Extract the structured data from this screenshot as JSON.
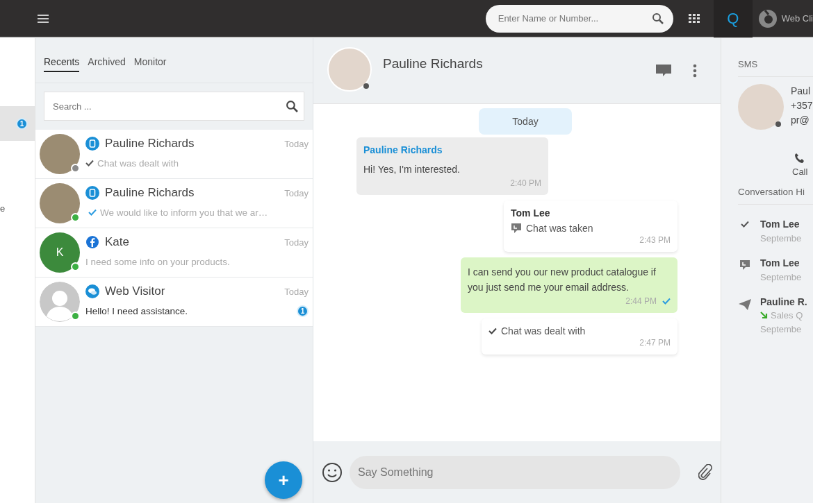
{
  "topbar": {
    "search": {
      "placeholder": "Enter Name or Number..."
    },
    "app_label": "Q",
    "user_label": "Web Cli"
  },
  "sidebar": {
    "items": [
      {
        "badge": "1",
        "selected": true
      },
      {
        "label": "e",
        "selected": false
      }
    ]
  },
  "list": {
    "tabs": [
      {
        "label": "Recents",
        "selected": true
      },
      {
        "label": "Archived",
        "selected": false
      },
      {
        "label": "Monitor",
        "selected": false
      }
    ],
    "search": {
      "placeholder": "Search ..."
    },
    "conversations": [
      {
        "avatar": {
          "kind": "photo"
        },
        "channel": {
          "kind": "messenger"
        },
        "name": "Pauline Richards",
        "time": "Today",
        "status_mark": {
          "kind": "dealt"
        },
        "preview": "Chat was dealt with",
        "color": "#8a8a8a"
      },
      {
        "avatar": {
          "kind": "photo"
        },
        "channel": {
          "kind": "messenger"
        },
        "name": "Pauline Richards",
        "time": "Today",
        "status_mark": {
          "kind": "delivered"
        },
        "preview": "We would like to inform you that we ar…",
        "color": "#3cb043"
      },
      {
        "avatar": {
          "kind": "initial",
          "initial": "K"
        },
        "channel": {
          "kind": "facebook"
        },
        "name": "Kate",
        "time": "Today",
        "preview": "I need some info on your products.",
        "color": "#3cb043"
      },
      {
        "avatar": {
          "kind": "generic"
        },
        "channel": {
          "kind": "webchat"
        },
        "name": "Web Visitor",
        "time": "Today",
        "preview": "Hello! I need assistance.",
        "color": "#3cb043",
        "unread": "1"
      }
    ],
    "fab": "+"
  },
  "chat": {
    "name": "Pauline Richards",
    "color": "#555555",
    "date": "Today",
    "messages": [
      {
        "kind": "incoming",
        "sender": "Pauline Richards",
        "text": "Hi! Yes, I'm interested.",
        "time": "2:40 PM"
      },
      {
        "kind": "taken",
        "sender": "Tom Lee",
        "text": "Chat was taken",
        "time": "2:43 PM"
      },
      {
        "kind": "outgoing",
        "text": "I can send you our new product catalogue if you just send me your email address.",
        "time": "2:44 PM",
        "delivered": true
      },
      {
        "kind": "dealt",
        "text": "Chat was dealt with",
        "time": "2:47 PM"
      }
    ],
    "composer": {
      "placeholder": "Say Something"
    }
  },
  "details": {
    "section": "SMS",
    "contact": {
      "name": "Paul",
      "phone": "+357",
      "email": "pr@",
      "color": "#555555"
    },
    "call": "Call",
    "history_title": "Conversation Hi",
    "history": [
      {
        "kind": "dealt",
        "name": "Tom Lee",
        "date": "Septembe"
      },
      {
        "kind": "taken",
        "name": "Tom Lee",
        "date": "Septembe"
      },
      {
        "kind": "sent",
        "name": "Pauline R.",
        "sub": "Sales Q",
        "date": "Septembe"
      }
    ]
  }
}
